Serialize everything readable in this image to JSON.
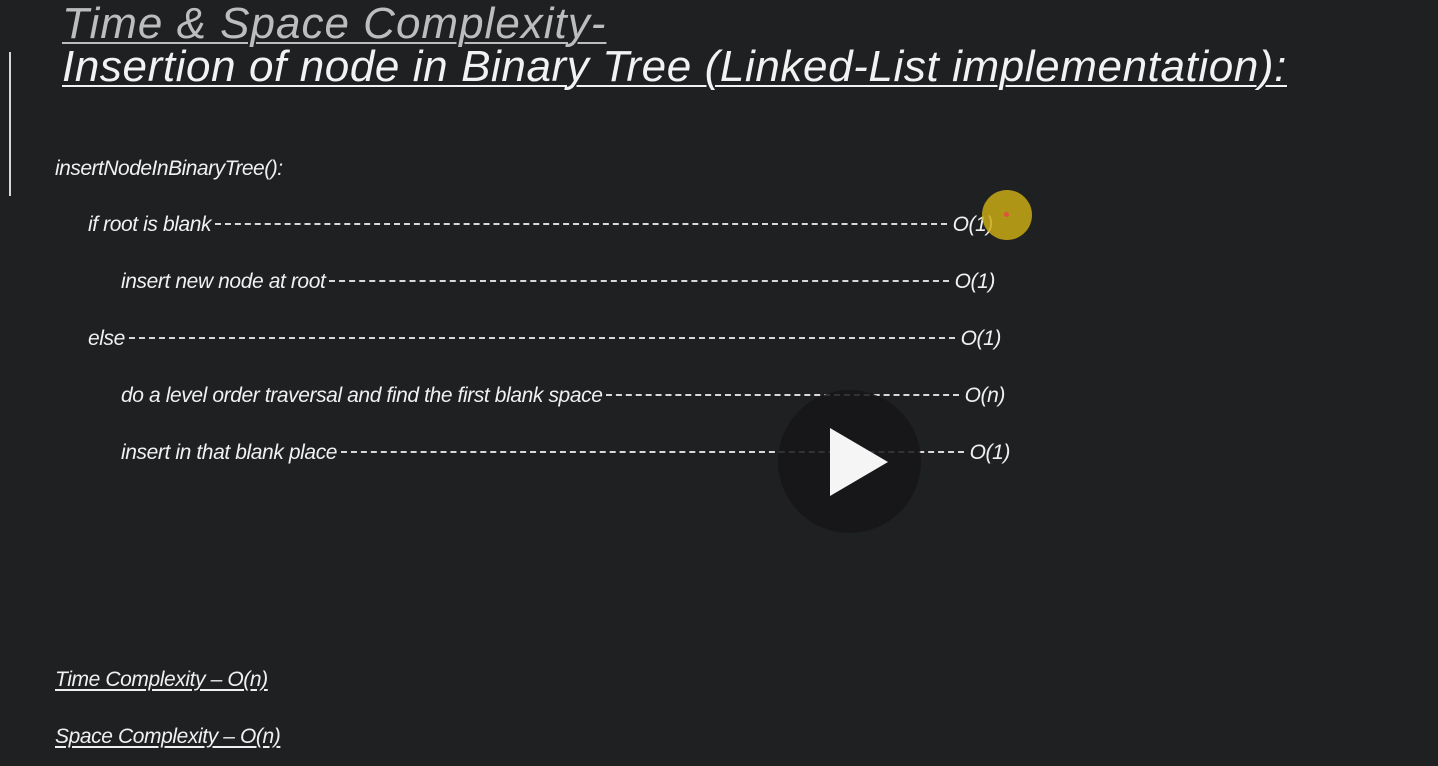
{
  "slide": {
    "title_line1": "Time & Space Complexity-",
    "title_line2": "Insertion of node in Binary Tree (Linked-List implementation):",
    "function_name": "insertNodeInBinaryTree():",
    "lines": [
      {
        "statement": "if root is blank",
        "cost": "O(1)"
      },
      {
        "statement": "insert new node at root",
        "cost": "O(1)"
      },
      {
        "statement": "else",
        "cost": "O(1)"
      },
      {
        "statement": "do a level order traversal and find the first blank space",
        "cost": "O(n)"
      },
      {
        "statement": "insert in that blank place",
        "cost": "O(1)"
      }
    ],
    "time_complexity": "Time Complexity – O(n)",
    "space_complexity": "Space Complexity – O(n)"
  },
  "overlay": {
    "play_icon": "play-icon",
    "cursor_color": "#c8aa14",
    "play_button_color": "#161618"
  }
}
